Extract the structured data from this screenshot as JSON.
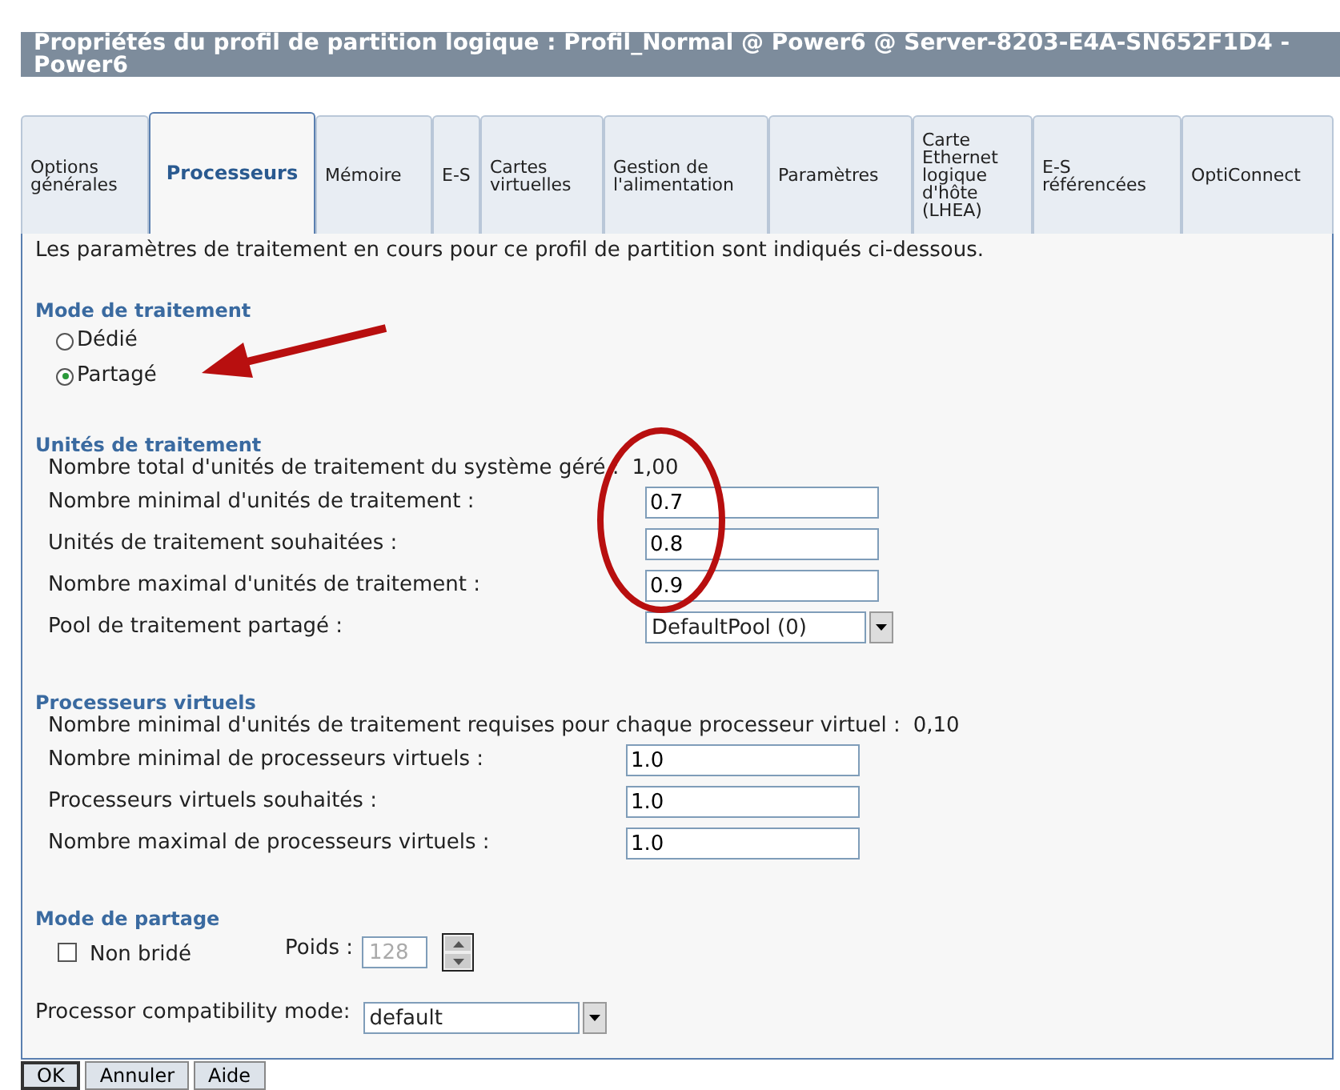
{
  "window": {
    "title": "Propriétés du profil de partition logique : Profil_Normal @ Power6 @ Server-8203-E4A-SN652F1D4 - Power6"
  },
  "tabs": [
    {
      "label": "Options générales",
      "selected": false
    },
    {
      "label": "Processeurs",
      "selected": true
    },
    {
      "label": "Mémoire",
      "selected": false
    },
    {
      "label": "E-S",
      "selected": false
    },
    {
      "label": "Cartes virtuelles",
      "selected": false
    },
    {
      "label": "Gestion de l'alimentation",
      "selected": false
    },
    {
      "label": "Paramètres",
      "selected": false
    },
    {
      "label": "Carte Ethernet logique d'hôte (LHEA)",
      "selected": false
    },
    {
      "label": "E-S référencées",
      "selected": false
    },
    {
      "label": "OptiConnect",
      "selected": false
    }
  ],
  "intro": "Les paramètres de traitement en cours pour ce profil de partition sont indiqués ci-dessous.",
  "processing_mode": {
    "heading": "Mode de traitement",
    "options": [
      {
        "label": "Dédié",
        "selected": false
      },
      {
        "label": "Partagé",
        "selected": true
      }
    ]
  },
  "processing_units": {
    "heading": "Unités de traitement",
    "rows": [
      {
        "kind": "readout",
        "label": "Nombre total d'unités de traitement du système géré :",
        "value": "1,00"
      },
      {
        "kind": "input",
        "label": "Nombre minimal d'unités de traitement :",
        "value": "0.7"
      },
      {
        "kind": "input",
        "label": "Unités de traitement souhaitées :",
        "value": "0.8"
      },
      {
        "kind": "input",
        "label": "Nombre maximal d'unités de traitement :",
        "value": "0.9"
      },
      {
        "kind": "select",
        "label": "Pool de traitement partagé :",
        "value": "DefaultPool (0)"
      }
    ]
  },
  "virtual_processors": {
    "heading": "Processeurs virtuels",
    "rows": [
      {
        "kind": "readout",
        "label": "Nombre minimal d'unités de traitement requises pour chaque processeur virtuel :",
        "value": "0,10"
      },
      {
        "kind": "input",
        "label": "Nombre minimal de processeurs virtuels :",
        "value": "1.0"
      },
      {
        "kind": "input",
        "label": "Processeurs virtuels souhaités :",
        "value": "1.0"
      },
      {
        "kind": "input",
        "label": "Nombre maximal de processeurs virtuels :",
        "value": "1.0"
      }
    ]
  },
  "sharing_mode": {
    "heading": "Mode de partage",
    "uncapped": {
      "label": "Non bridé",
      "checked": false
    },
    "weight": {
      "label": "Poids :",
      "value": "128",
      "disabled": true
    }
  },
  "compatibility": {
    "label": "Processor compatibility mode:",
    "value": "default"
  },
  "buttons": [
    "OK",
    "Annuler",
    "Aide"
  ],
  "annotations": {
    "arrow": true,
    "ellipse": true
  }
}
